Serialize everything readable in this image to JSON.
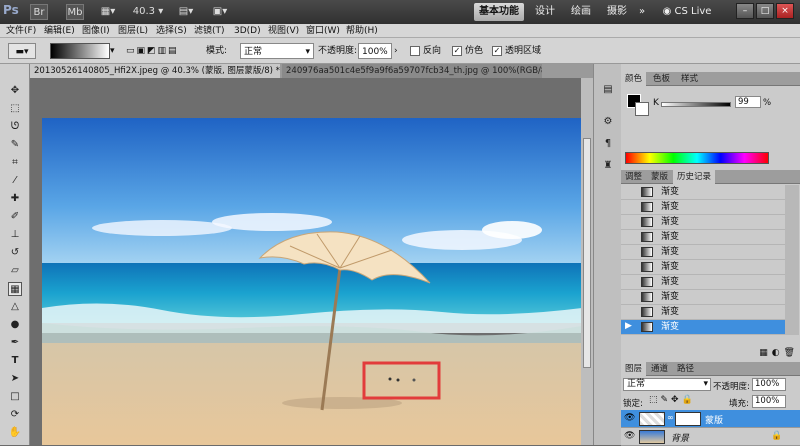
{
  "titlebar": {
    "logo": "Ps",
    "br_label": "Br",
    "mb_label": "Mb",
    "zoom": "40.3",
    "workspaces": [
      "基本功能",
      "设计",
      "绘画",
      "摄影"
    ],
    "more": "»",
    "cslive": "CS Live",
    "win_buttons": [
      "–",
      "□",
      "×"
    ]
  },
  "menubar": [
    "文件(F)",
    "编辑(E)",
    "图像(I)",
    "图层(L)",
    "选择(S)",
    "滤镜(T)",
    "3D(D)",
    "视图(V)",
    "窗口(W)",
    "帮助(H)"
  ],
  "options": {
    "mode_label": "模式:",
    "mode_value": "正常",
    "opacity_label": "不透明度:",
    "opacity_value": "100%",
    "reverse_label": "反向",
    "dither_label": "仿色",
    "transparency_label": "透明区域"
  },
  "tabs": [
    "20130526140805_Hfi2X.jpeg @ 40.3% (蒙版, 图层蒙版/8) * ×",
    "240976aa501c4e5f9a9f6a59707fcb34_th.jpg @ 100%(RGB/8#) ×"
  ],
  "color_panel": {
    "tabs": [
      "颜色",
      "色板",
      "样式"
    ],
    "channel": "K",
    "value": "99",
    "unit": "%"
  },
  "history_panel": {
    "tabs": [
      "调整",
      "蒙版",
      "历史记录"
    ],
    "items": [
      "渐变",
      "渐变",
      "渐变",
      "渐变",
      "渐变",
      "渐变",
      "渐变",
      "渐变",
      "渐变",
      "渐变"
    ],
    "selected_index": 9
  },
  "layers_panel": {
    "tabs": [
      "图层",
      "通道",
      "路径"
    ],
    "blend_mode": "正常",
    "opacity_label": "不透明度:",
    "opacity_value": "100%",
    "lock_label": "锁定:",
    "fill_label": "填充:",
    "fill_value": "100%",
    "layers": [
      {
        "name": "蒙版",
        "selected": true
      },
      {
        "name": "背景",
        "selected": false
      }
    ]
  },
  "colors": {
    "accent": "#3f8fde",
    "highlight_box": "#e23b3b"
  }
}
